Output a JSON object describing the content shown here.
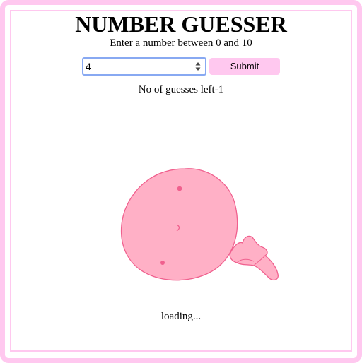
{
  "header": {
    "title": "NUMBER GUESSER",
    "instruction": "Enter a number between 0 and 10"
  },
  "form": {
    "input_value": "4",
    "submit_label": "Submit"
  },
  "status": {
    "guesses_left": "No of guesses left-1",
    "loading": "loading..."
  },
  "colors": {
    "accent": "#ffc8ef",
    "mascot_fill": "#ffb0c6",
    "mascot_stroke": "#f0608e",
    "input_focus_border": "#88a9f2"
  },
  "icons": {
    "spinner": "number-spinner-icon",
    "mascot": "pink-blob-mascot"
  }
}
